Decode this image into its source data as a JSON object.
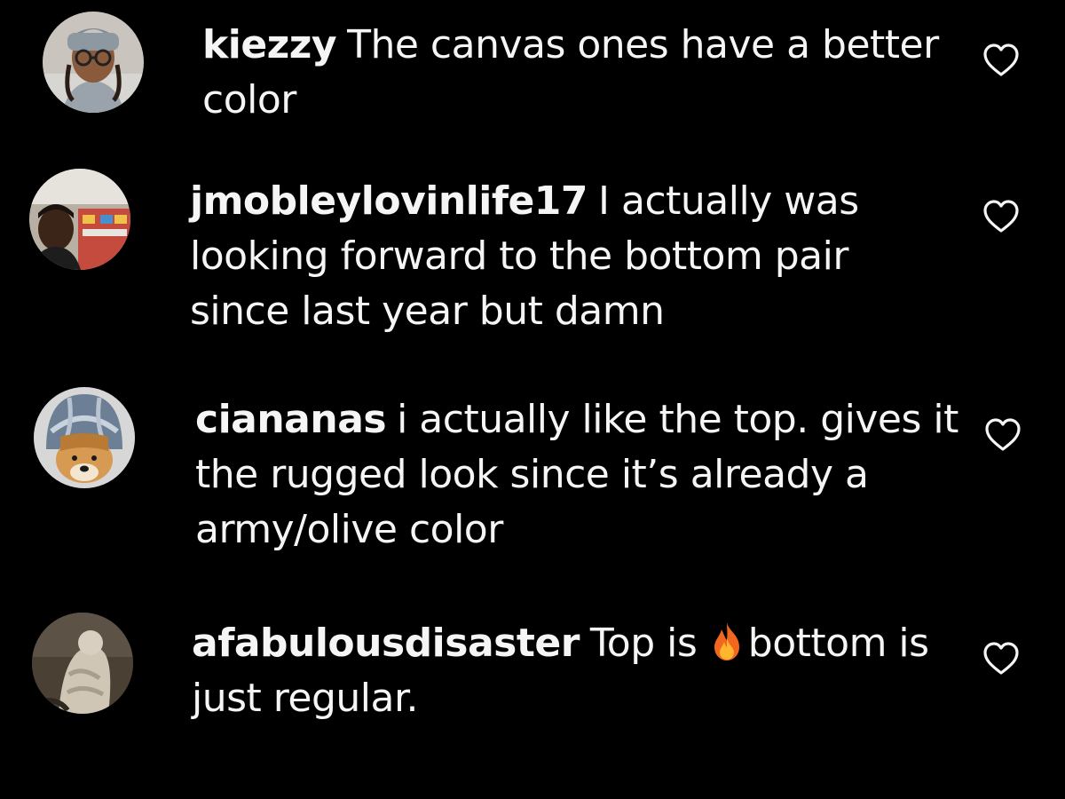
{
  "theme": {
    "background": "#000000",
    "text": "#f5f5f5"
  },
  "comments": [
    {
      "username": "kiezzy",
      "text": "The canvas ones have a better color",
      "avatar_icon": "user-avatar-glasses",
      "like_icon": "heart-outline-icon"
    },
    {
      "username": "jmobleylovinlife17",
      "text": "I actually was looking forward to the bottom pair since last year but damn",
      "avatar_icon": "user-avatar-store",
      "like_icon": "heart-outline-icon"
    },
    {
      "username": "ciananas",
      "text": "i actually like the top. gives it the rugged look since it’s already a army/olive color",
      "avatar_icon": "user-avatar-dog",
      "like_icon": "heart-outline-icon"
    },
    {
      "username": "afabulousdisaster",
      "text_before": "Top is",
      "emoji": "fire-emoji",
      "text_after": "bottom is just regular.",
      "avatar_icon": "user-avatar-statue",
      "like_icon": "heart-outline-icon"
    }
  ]
}
